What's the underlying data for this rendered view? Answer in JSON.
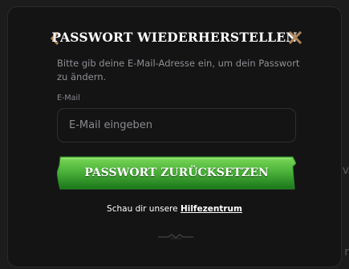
{
  "modal": {
    "title": "PASSWORT WIEDERHERSTELLEN",
    "description": "Bitte gib deine E-Mail-Adresse ein, um dein Passwort zu ändern.",
    "email_label": "E-Mail",
    "email_placeholder": "E-Mail eingeben",
    "email_value": "",
    "submit_label": "PASSWORT ZURÜCKSETZEN",
    "help_text": "Schau dir unsere",
    "help_link": "Hilfezentrum"
  },
  "icons": {
    "back": "chevron-left-icon",
    "close": "close-icon",
    "ornament": "ornament-divider-icon"
  },
  "colors": {
    "modal_bg": "#141415",
    "accent_brown": "#b0865a",
    "button_green_top": "#6fd24f",
    "button_green_bottom": "#1d7a1c"
  }
}
